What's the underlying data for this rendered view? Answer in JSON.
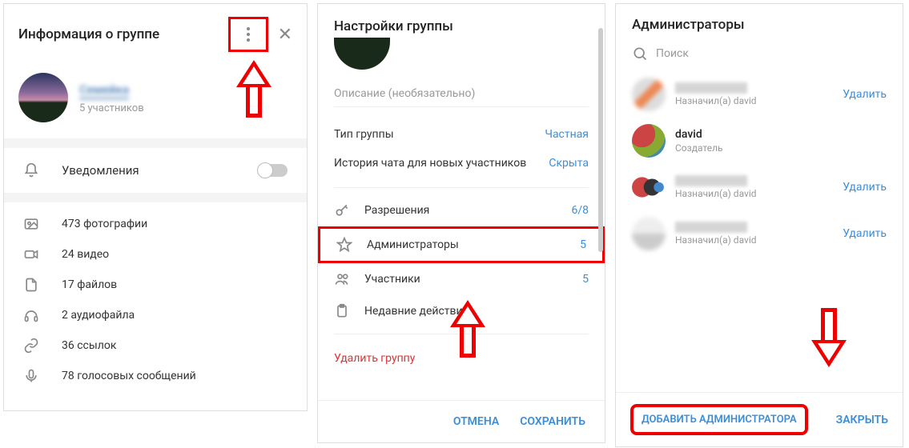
{
  "panel1": {
    "title": "Информация о группе",
    "group_name": "Семейка",
    "members_count": "5 участников",
    "notifications_label": "Уведомления",
    "media": [
      {
        "icon": "photo-icon",
        "label": "473 фотографии"
      },
      {
        "icon": "video-icon",
        "label": "24 видео"
      },
      {
        "icon": "file-icon",
        "label": "17 файлов"
      },
      {
        "icon": "audio-icon",
        "label": "2 аудиофайла"
      },
      {
        "icon": "link-icon",
        "label": "36 ссылок"
      },
      {
        "icon": "voice-icon",
        "label": "78 голосовых сообщений"
      }
    ]
  },
  "panel2": {
    "title": "Настройки группы",
    "description_placeholder": "Описание (необязательно)",
    "type_label": "Тип группы",
    "type_value": "Частная",
    "history_label": "История чата для новых участников",
    "history_value": "Скрыта",
    "items": [
      {
        "icon": "key-icon",
        "label": "Разрешения",
        "count": "6/8"
      },
      {
        "icon": "star-icon",
        "label": "Администраторы",
        "count": "5",
        "highlighted": true
      },
      {
        "icon": "members-icon",
        "label": "Участники",
        "count": "5"
      },
      {
        "icon": "clipboard-icon",
        "label": "Недавние действия",
        "count": ""
      }
    ],
    "delete_label": "Удалить группу",
    "cancel_label": "ОТМЕНА",
    "save_label": "СОХРАНИТЬ"
  },
  "panel3": {
    "title": "Администраторы",
    "search_placeholder": "Поиск",
    "admins": [
      {
        "name": "",
        "sub": "Назначил(а) david",
        "blurred": true,
        "av": "av1",
        "deletable": true
      },
      {
        "name": "david",
        "sub": "Создатель",
        "blurred": false,
        "av": "av2",
        "deletable": false
      },
      {
        "name": "",
        "sub": "Назначил(а) david",
        "blurred": true,
        "av": "av3",
        "deletable": true
      },
      {
        "name": "",
        "sub": "Назначил(а) david",
        "blurred": true,
        "av": "av4",
        "deletable": true
      }
    ],
    "delete_label": "Удалить",
    "add_label": "ДОБАВИТЬ АДМИНИСТРАТОРА",
    "close_label": "ЗАКРЫТЬ"
  }
}
